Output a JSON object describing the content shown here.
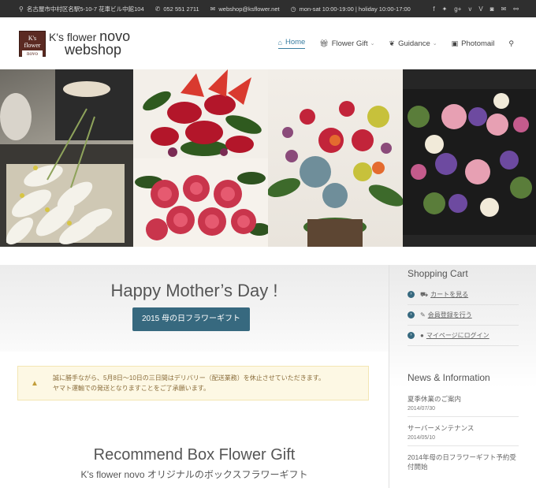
{
  "topbar": {
    "address": "名古屋市中村区名駅5-10-7 花車ビル中館104",
    "phone": "052 551 2711",
    "email": "webshop@ksflower.net",
    "hours": "mon-sat 10:00-19:00 | holiday 10:00-17:00",
    "social_icons": [
      "facebook-icon",
      "twitter-icon",
      "google-plus-icon",
      "vimeo-icon",
      "vine-icon",
      "instagram-icon",
      "mail-icon",
      "link-icon"
    ]
  },
  "logo": {
    "box_line1": "K's",
    "box_line2": "flower",
    "box_line3": "novo",
    "text_line1_a": "K's flower ",
    "text_line1_b": "novo",
    "text_line2": "webshop"
  },
  "nav": {
    "items": [
      {
        "label": "Home",
        "icon": "home-icon"
      },
      {
        "label": "Flower Gift",
        "icon": "gift-icon"
      },
      {
        "label": "Guidance",
        "icon": "leaf-icon"
      },
      {
        "label": "Photomail",
        "icon": "image-icon"
      }
    ]
  },
  "main": {
    "hero_title": "Happy Mother’s Day !",
    "cta_label": "2015 母の日フラワーギフト",
    "notice_line1": "誠に勝手ながら、5月8日〜10日の三日間はデリバリー（配送業務）を休止させていただきます。",
    "notice_line2": "ヤマト運輸での発送となりますことをご了承願います。",
    "rec_title": "Recommend Box Flower Gift",
    "rec_sub": "K's flower novo オリジナルのボックスフラワーギフト"
  },
  "sidebar": {
    "cart_heading": "Shopping Cart",
    "cart_items": [
      {
        "label": "カートを見る",
        "icon": "cart-icon"
      },
      {
        "label": "会員登録を行う",
        "icon": "pencil-icon"
      },
      {
        "label": "マイページにログイン",
        "icon": "user-icon"
      }
    ],
    "news_heading": "News & Information",
    "news": [
      {
        "title": "夏季休業のご案内",
        "date": "2014/07/30"
      },
      {
        "title": "サーバーメンテナンス",
        "date": "2014/05/10"
      },
      {
        "title": "2014年母の日フラワーギフト予約受付開始",
        "date": ""
      }
    ]
  },
  "colors": {
    "accent": "#3a7ea1",
    "button": "#37697f",
    "topbar": "#2f2f2f",
    "notice_bg": "#fdf8e4"
  }
}
